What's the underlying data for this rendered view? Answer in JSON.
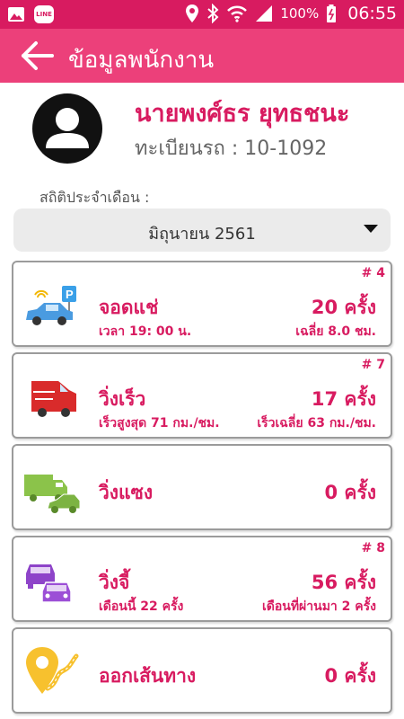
{
  "status_bar": {
    "battery": "100%",
    "time": "06:55",
    "line_app": "LINE"
  },
  "header": {
    "title": "ข้อมูลพนักงาน"
  },
  "employee": {
    "name": "นายพงศ์ธร ยุทธชนะ",
    "plate": "ทะเบียนรถ : 10-1092"
  },
  "stats": {
    "label": "สถิติประจำเดือน :",
    "selected_month": "มิถุนายน  2561"
  },
  "cards": [
    {
      "icon": "parked-car-icon",
      "rank": "# 4",
      "title": "จอดแช่",
      "count": "20 ครั้ง",
      "sub_left": "เวลา 19: 00 น.",
      "sub_right": "เฉลี่ย 8.0 ชม."
    },
    {
      "icon": "speeding-truck-icon",
      "rank": "# 7",
      "title": "วิ่งเร็ว",
      "count": "17 ครั้ง",
      "sub_left": "เร็วสูงสุด 71 กม./ชม.",
      "sub_right": "เร็วเฉลี่ย 63 กม./ชม."
    },
    {
      "icon": "overtaking-icon",
      "title": "วิ่งแซง",
      "count": "0 ครั้ง"
    },
    {
      "icon": "tailgating-cars-icon",
      "rank": "# 8",
      "title": "วิ่งจี้",
      "count": "56 ครั้ง",
      "sub_left": "เดือนนี้ 22 ครั้ง",
      "sub_right": "เดือนที่ผ่านมา 2 ครั้ง"
    },
    {
      "icon": "off-route-icon",
      "title": "ออกเส้นทาง",
      "count": "0 ครั้ง"
    }
  ],
  "colors": {
    "status_bar": "#d81b60",
    "app_bar": "#ec407a",
    "accent_text": "#d81b60"
  }
}
